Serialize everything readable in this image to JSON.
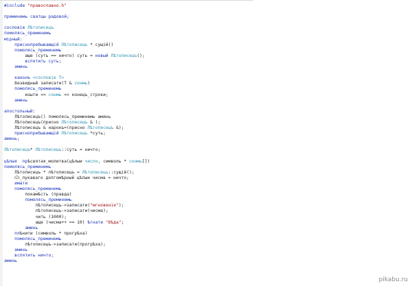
{
  "code": {
    "lines": [
      {
        "indent": 0,
        "parts": [
          {
            "t": "#include ",
            "c": "kw"
          },
          {
            "t": "\"православно.h\"",
            "c": "str"
          }
        ]
      },
      {
        "indent": 0,
        "parts": []
      },
      {
        "indent": 0,
        "parts": [
          {
            "t": "преминемь сватцы радовой;",
            "c": "kw"
          }
        ]
      },
      {
        "indent": 0,
        "parts": []
      },
      {
        "indent": 0,
        "parts": [
          {
            "t": "сословіе ",
            "c": "kw"
          },
          {
            "t": "Лѣтописецъ",
            "c": "ty"
          }
        ]
      },
      {
        "indent": 0,
        "parts": [
          {
            "t": "помолясь_преминемь",
            "c": "kw"
          }
        ]
      },
      {
        "indent": 0,
        "parts": [
          {
            "t": "мірный:",
            "c": "kw"
          }
        ]
      },
      {
        "indent": 1,
        "parts": [
          {
            "t": "приснопребывающій ",
            "c": "kw"
          },
          {
            "t": "Лѣтописецъ",
            "c": "ty"
          },
          {
            "t": " * сущій()",
            "c": ""
          }
        ]
      },
      {
        "indent": 1,
        "parts": [
          {
            "t": "помолясь_преминемь",
            "c": "kw"
          }
        ]
      },
      {
        "indent": 2,
        "parts": [
          {
            "t": "аще (суть == ничто) суть = ",
            "c": ""
          },
          {
            "t": "новый ",
            "c": "kw"
          },
          {
            "t": "Лѣтописецъ",
            "c": "ty"
          },
          {
            "t": "();",
            "c": ""
          }
        ]
      },
      {
        "indent": 2,
        "parts": [
          {
            "t": "вспятить суть;",
            "c": "kw"
          }
        ]
      },
      {
        "indent": 1,
        "parts": [
          {
            "t": "аминь",
            "c": "kw"
          }
        ]
      },
      {
        "indent": 0,
        "parts": []
      },
      {
        "indent": 1,
        "parts": [
          {
            "t": "канонъ ",
            "c": "kw"
          },
          {
            "t": "<сословіе T>",
            "c": "ty"
          }
        ]
      },
      {
        "indent": 1,
        "parts": [
          {
            "t": "безвидный записати(T & ",
            "c": ""
          },
          {
            "t": "сонмь",
            "c": "ty"
          },
          {
            "t": ")",
            "c": ""
          }
        ]
      },
      {
        "indent": 1,
        "parts": [
          {
            "t": "помолясь_преминемь",
            "c": "kw"
          }
        ]
      },
      {
        "indent": 2,
        "parts": [
          {
            "t": "изыти << ",
            "c": ""
          },
          {
            "t": "сонмь",
            "c": "ty"
          },
          {
            "t": " << конецъ_строки;",
            "c": ""
          }
        ]
      },
      {
        "indent": 1,
        "parts": [
          {
            "t": "аминь",
            "c": "kw"
          }
        ]
      },
      {
        "indent": 0,
        "parts": []
      },
      {
        "indent": 0,
        "parts": [
          {
            "t": "апостольный:",
            "c": "kw"
          }
        ]
      },
      {
        "indent": 1,
        "parts": [
          {
            "t": "Лѣтописецъ() помолясь_преминемь аминь",
            "c": ""
          }
        ]
      },
      {
        "indent": 1,
        "parts": [
          {
            "t": "Лѣтописецъ(присно ",
            "c": ""
          },
          {
            "t": "Лѣтописецъ",
            "c": "ty"
          },
          {
            "t": " & );",
            "c": ""
          }
        ]
      },
      {
        "indent": 1,
        "parts": [
          {
            "t": "Лѣтописецъ & нарокъ=(присно ",
            "c": ""
          },
          {
            "t": "Лѣтописецъ",
            "c": "ty"
          },
          {
            "t": " &);",
            "c": ""
          }
        ]
      },
      {
        "indent": 1,
        "parts": [
          {
            "t": "приснопребывающій ",
            "c": "kw"
          },
          {
            "t": "Лѣтописецъ",
            "c": "ty"
          },
          {
            "t": " *суть;",
            "c": ""
          }
        ]
      },
      {
        "indent": 0,
        "parts": [
          {
            "t": "аминь;",
            "c": "kw"
          }
        ]
      },
      {
        "indent": 0,
        "parts": []
      },
      {
        "indent": 0,
        "parts": [
          {
            "t": "Лѣтописецъ",
            "c": "ty"
          },
          {
            "t": "* ",
            "c": ""
          },
          {
            "t": "Лѣтописецъ",
            "c": "ty"
          },
          {
            "t": "::суть = ничто;",
            "c": ""
          }
        ]
      },
      {
        "indent": 0,
        "parts": []
      },
      {
        "indent": 0,
        "parts": [
          {
            "t": "цѣлыя  пр",
            "c": "kw"
          },
          {
            "t": "ѣсвятая_молитва(цѣлыи ",
            "c": ""
          },
          {
            "t": "число",
            "c": "ty"
          },
          {
            "t": ", символь * ",
            "c": ""
          },
          {
            "t": "сонмь",
            "c": "ty"
          },
          {
            "t": "[])",
            "c": ""
          }
        ]
      },
      {
        "indent": 0,
        "parts": [
          {
            "t": "помолясь_преминемь",
            "c": "kw"
          }
        ]
      },
      {
        "indent": 1,
        "parts": [
          {
            "t": "Лѣтописецъ * лѣтописецъ = ",
            "c": ""
          },
          {
            "t": "Лѣтописецъ",
            "c": "ty"
          },
          {
            "t": "::сущій();",
            "c": ""
          }
        ]
      },
      {
        "indent": 1,
        "parts": [
          {
            "t": "Ѿ_лукаваго долгомѣрный цѣлыи чисма = ничто;",
            "c": ""
          }
        ]
      },
      {
        "indent": 1,
        "parts": [
          {
            "t": "имати",
            "c": "kw"
          }
        ]
      },
      {
        "indent": 1,
        "parts": [
          {
            "t": "помолясь_преминемь",
            "c": "kw"
          }
        ]
      },
      {
        "indent": 2,
        "parts": [
          {
            "t": "покамѣсть (правда)",
            "c": ""
          }
        ]
      },
      {
        "indent": 2,
        "parts": [
          {
            "t": "помолясь_преминемь",
            "c": "kw"
          }
        ]
      },
      {
        "indent": 3,
        "parts": [
          {
            "t": "лѣтописецъ->записати(",
            "c": ""
          },
          {
            "t": "\"мгновеніе\"",
            "c": "str"
          },
          {
            "t": ");",
            "c": ""
          }
        ]
      },
      {
        "indent": 3,
        "parts": [
          {
            "t": "лѣтописецъ->записати(чисма);",
            "c": ""
          }
        ]
      },
      {
        "indent": 3,
        "parts": [
          {
            "t": "чить (1000);",
            "c": ""
          }
        ]
      },
      {
        "indent": 3,
        "parts": [
          {
            "t": "аще (чисма++ == 10) ",
            "c": ""
          },
          {
            "t": "ѣгнати ",
            "c": "kw"
          },
          {
            "t": "\"бѣда\"",
            "c": "str"
          },
          {
            "t": ";",
            "c": ""
          }
        ]
      },
      {
        "indent": 2,
        "parts": [
          {
            "t": "аминь",
            "c": "kw"
          }
        ]
      },
      {
        "indent": 1,
        "parts": [
          {
            "t": "пл",
            "c": "kw"
          },
          {
            "t": "ѣнити (символь * прогрѣха)",
            "c": ""
          }
        ]
      },
      {
        "indent": 1,
        "parts": [
          {
            "t": "помолясь_преминемь",
            "c": "kw"
          }
        ]
      },
      {
        "indent": 2,
        "parts": [
          {
            "t": "лѣтописецъ->записати(прогрѣха);",
            "c": ""
          }
        ]
      },
      {
        "indent": 1,
        "parts": [
          {
            "t": "аминь",
            "c": "kw"
          }
        ]
      },
      {
        "indent": 1,
        "parts": [
          {
            "t": "вспятить ничто;",
            "c": "kw"
          }
        ]
      },
      {
        "indent": 0,
        "parts": [
          {
            "t": "аминь",
            "c": "kw"
          }
        ]
      }
    ]
  },
  "watermark": "pikabu.ru"
}
